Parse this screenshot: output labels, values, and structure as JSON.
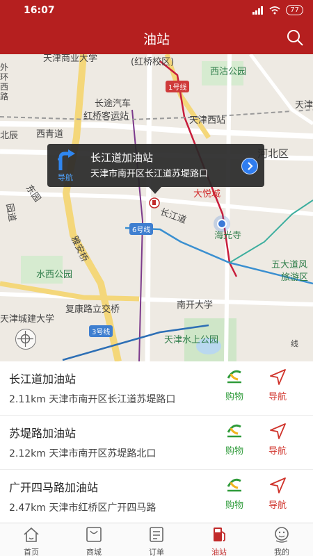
{
  "status_bar": {
    "time": "16:07",
    "battery": "77"
  },
  "header": {
    "title": "油站",
    "search_icon": "search-icon"
  },
  "map": {
    "labels": {
      "tianjin_shangye": "天津商业大学",
      "hongqiao_xiaoqu": "(红桥校区)",
      "xigu_park": "西沽公园",
      "waihuan": "外环西路",
      "line1": "1号线",
      "tianjin": "天津",
      "changtu_1": "长途汽车",
      "changtu_2": "红桥客运站",
      "tianjin_west": "天津西站",
      "beichen": "北辰",
      "xiqing_road": "西青道",
      "hebei_district": "河北区",
      "joy_city": "大悦城",
      "dongyuan": "东园",
      "dongyuan2": "园道",
      "changjiang_road": "长江道",
      "line6": "6号线",
      "yaanqiao": "雅安桥",
      "haiguangsi": "海光寺",
      "wudadao_1": "五大道风",
      "wudadao_2": "旅游区",
      "shuixi_park": "水西公园",
      "nankai_uni": "南开大学",
      "fukang_bridge": "复康路立交桥",
      "chengjian_uni": "天津城建大学",
      "line3": "3号线",
      "shuishang_park": "天津水上公园",
      "line_edge": "线"
    }
  },
  "popup": {
    "nav_label": "导航",
    "name": "长江道加油站",
    "address": "天津市南开区长江道苏堤路口"
  },
  "stations": [
    {
      "name": "长江道加油站",
      "detail": "2.11km 天津市南开区长江道苏堤路口",
      "shop_label": "购物",
      "nav_label": "导航"
    },
    {
      "name": "苏堤路加油站",
      "detail": "2.12km 天津市南开区苏堤路北口",
      "shop_label": "购物",
      "nav_label": "导航"
    },
    {
      "name": "广开四马路加油站",
      "detail": "2.47km 天津市红桥区广开四马路",
      "shop_label": "购物",
      "nav_label": "导航"
    }
  ],
  "tabs": [
    {
      "label": "首页",
      "icon": "home-icon",
      "active": false
    },
    {
      "label": "商城",
      "icon": "bag-icon",
      "active": false
    },
    {
      "label": "订单",
      "icon": "order-icon",
      "active": false
    },
    {
      "label": "油站",
      "icon": "fuel-icon",
      "active": true
    },
    {
      "label": "我的",
      "icon": "profile-icon",
      "active": false
    }
  ],
  "colors": {
    "brand_red": "#b51f1f",
    "shop_green": "#2f9b3a",
    "nav_red": "#d0342c",
    "popup_blue": "#2f7df0"
  }
}
